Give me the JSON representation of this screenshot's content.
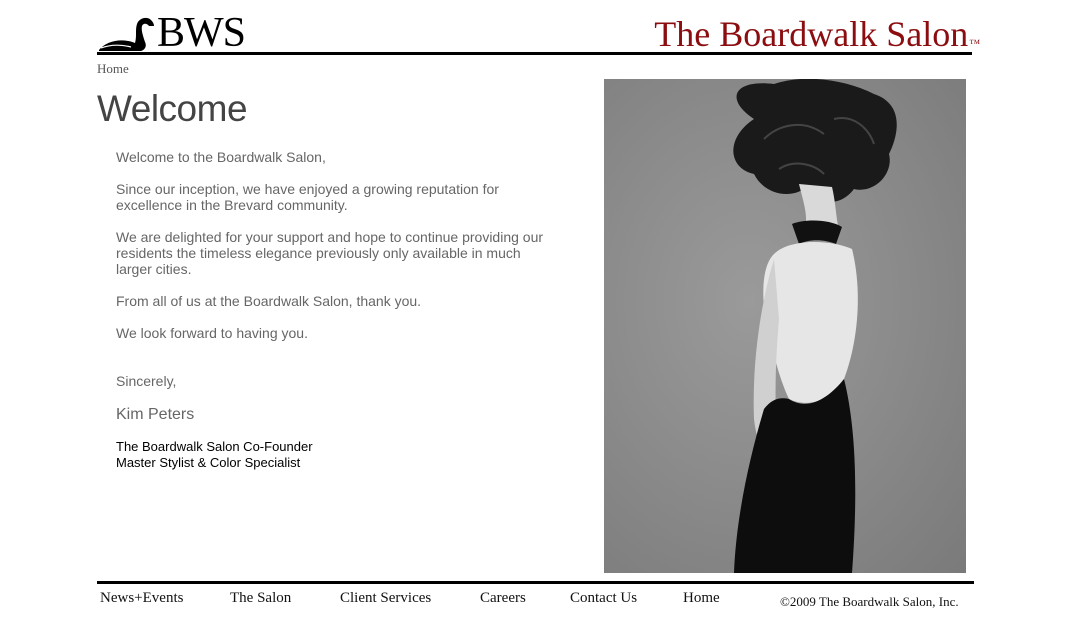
{
  "header": {
    "logo_text": "BWS",
    "logo_icon": "swan-icon",
    "salon_name": "The Boardwalk Salon",
    "trademark": "™"
  },
  "breadcrumb": "Home",
  "page_title": "Welcome",
  "letter": {
    "greeting": "Welcome to the Boardwalk Salon,",
    "paragraphs": [
      "Since our inception, we have enjoyed a growing reputation for excellence in the Brevard community.",
      "We are delighted for your support and hope to continue providing our residents the timeless elegance previously only available in much larger cities.",
      "From all of us at the Boardwalk Salon, thank you.",
      "We look forward to having you."
    ],
    "closing": "Sincerely,",
    "signer": "Kim Peters",
    "role_line_1": "The Boardwalk Salon Co-Founder",
    "role_line_2": "Master Stylist & Color Specialist"
  },
  "footer": {
    "nav": [
      {
        "label": "News+Events"
      },
      {
        "label": "The Salon"
      },
      {
        "label": "Client Services"
      },
      {
        "label": "Careers"
      },
      {
        "label": "Contact Us"
      },
      {
        "label": "Home"
      }
    ],
    "copyright": "©2009 The Boardwalk Salon, Inc."
  },
  "colors": {
    "brand_red": "#8b0d10",
    "text_gray": "#666666",
    "rule": "#000000"
  }
}
